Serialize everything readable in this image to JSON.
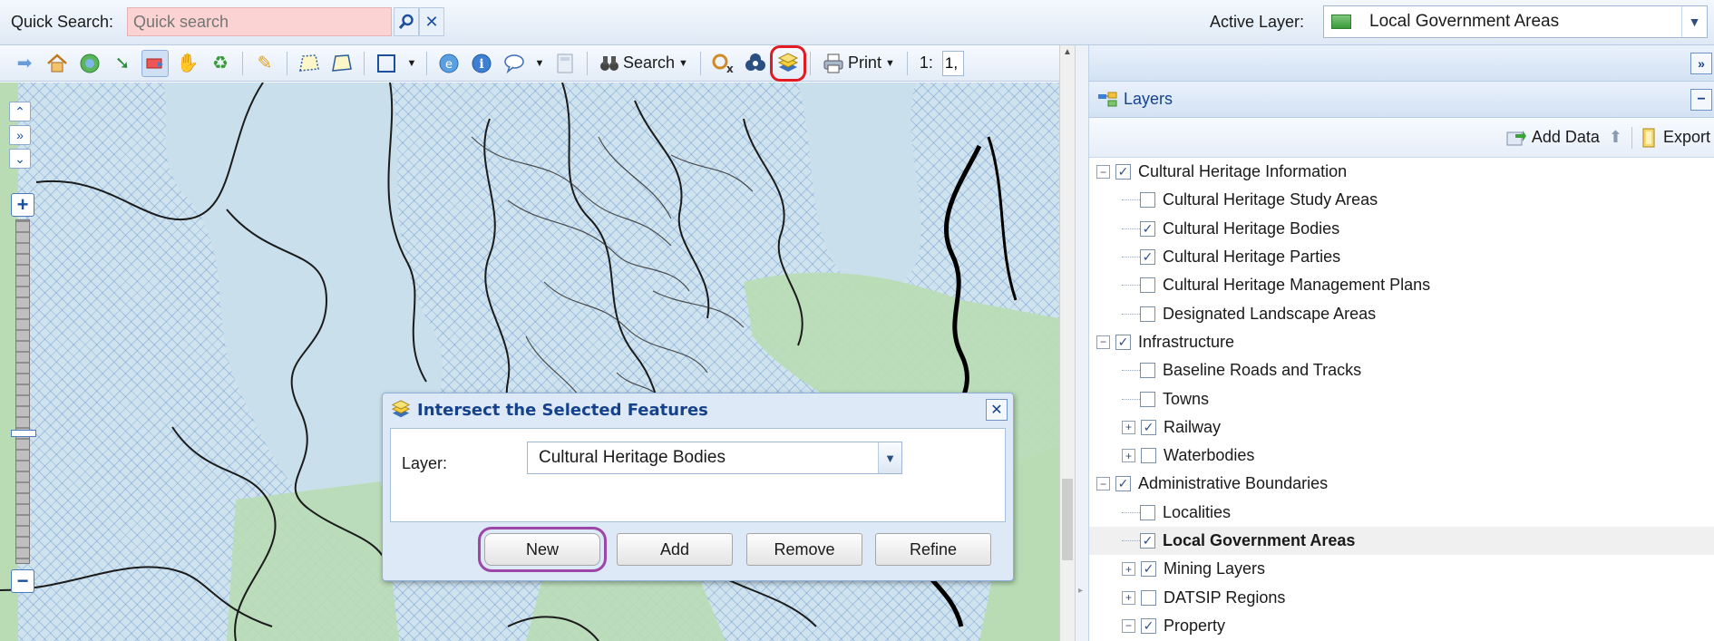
{
  "topbar": {
    "quick_search_label": "Quick Search:",
    "quick_search_placeholder": "Quick search",
    "active_layer_label": "Active Layer:",
    "active_layer_value": "Local Government Areas"
  },
  "toolbar": {
    "search_label": "Search",
    "print_label": "Print",
    "scale_prefix": "1:",
    "scale_value": "1,"
  },
  "dialog": {
    "title": "Intersect the Selected Features",
    "layer_label": "Layer:",
    "layer_value": "Cultural Heritage Bodies",
    "buttons": {
      "new": "New",
      "add": "Add",
      "remove": "Remove",
      "refine": "Refine"
    }
  },
  "panel": {
    "title": "Layers",
    "add_data_label": "Add Data",
    "export_label": "Export"
  },
  "tree": [
    {
      "label": "Cultural Heritage Information",
      "level": 0,
      "expander": "minus",
      "checked": true
    },
    {
      "label": "Cultural Heritage Study Areas",
      "level": 1,
      "expander": "none",
      "checked": false
    },
    {
      "label": "Cultural Heritage Bodies",
      "level": 1,
      "expander": "none",
      "checked": true
    },
    {
      "label": "Cultural Heritage Parties",
      "level": 1,
      "expander": "none",
      "checked": true
    },
    {
      "label": "Cultural Heritage Management Plans",
      "level": 1,
      "expander": "none",
      "checked": false
    },
    {
      "label": "Designated Landscape Areas",
      "level": 1,
      "expander": "none",
      "checked": false
    },
    {
      "label": "Infrastructure",
      "level": 0,
      "expander": "minus",
      "checked": true
    },
    {
      "label": "Baseline Roads and Tracks",
      "level": 1,
      "expander": "none",
      "checked": false
    },
    {
      "label": "Towns",
      "level": 1,
      "expander": "none",
      "checked": false
    },
    {
      "label": "Railway",
      "level": 1,
      "expander": "plus",
      "checked": true
    },
    {
      "label": "Waterbodies",
      "level": 1,
      "expander": "plus",
      "checked": false
    },
    {
      "label": "Administrative Boundaries",
      "level": 0,
      "expander": "minus",
      "checked": true
    },
    {
      "label": "Localities",
      "level": 1,
      "expander": "none",
      "checked": false
    },
    {
      "label": "Local Government Areas",
      "level": 1,
      "expander": "none",
      "checked": true,
      "selected": true
    },
    {
      "label": "Mining Layers",
      "level": 1,
      "expander": "plus",
      "checked": true
    },
    {
      "label": "DATSIP Regions",
      "level": 1,
      "expander": "plus",
      "checked": false
    },
    {
      "label": "Property",
      "level": 1,
      "expander": "minus",
      "checked": true
    }
  ],
  "colors": {
    "highlight_red": "#e11b22",
    "highlight_purple": "#9b46a8",
    "header_text": "#15428b",
    "map_green": "#b9dcb5"
  }
}
